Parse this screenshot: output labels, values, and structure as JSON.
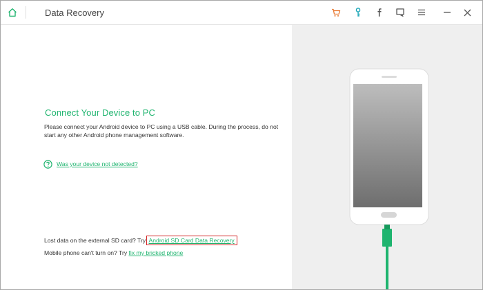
{
  "titlebar": {
    "app_title": "Data Recovery",
    "icons": [
      "home-icon",
      "cart-icon",
      "key-icon",
      "facebook-icon",
      "feedback-icon",
      "menu-icon",
      "minimize-icon",
      "close-icon"
    ],
    "accent_cart": "#e8772e",
    "accent_key": "#1aa6b7"
  },
  "main": {
    "heading": "Connect Your Device to PC",
    "description": "Please connect your Android device to PC using a USB cable. During the process, do not start any other Android phone management software.",
    "detect_link": "Was your device not detected?",
    "sd_prompt": "Lost data on the external SD card? Try",
    "sd_link": "Android SD Card Data Recovery",
    "bricked_prompt": "Mobile phone can't turn on? Try",
    "bricked_link": "fix my bricked phone"
  },
  "colors": {
    "accent_green": "#1fb46f",
    "panel_gray": "#efefef",
    "highlight_red": "#d22424"
  }
}
